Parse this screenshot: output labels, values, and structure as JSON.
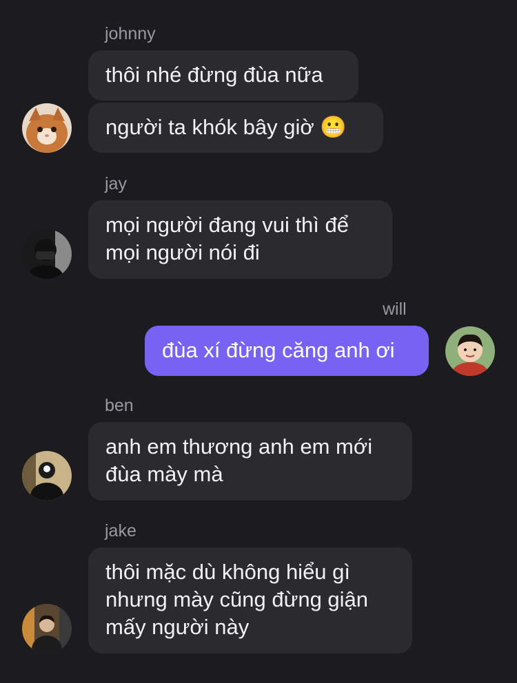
{
  "messages": [
    {
      "sender": "johnny",
      "bubbles": [
        {
          "lines": [
            "thôi nhé đừng đùa nữa"
          ]
        },
        {
          "lines": [
            "người ta khók bây giờ 😬"
          ]
        }
      ],
      "avatar_icon": "cat-avatar-icon"
    },
    {
      "sender": "jay",
      "bubbles": [
        {
          "lines": [
            "mọi người đang vui thì để",
            "mọi người nói đi"
          ]
        }
      ],
      "avatar_icon": "masked-person-avatar-icon"
    },
    {
      "sender": "will",
      "bubbles": [
        {
          "lines": [
            "đùa xí đừng căng anh ơi"
          ]
        }
      ],
      "avatar_icon": "child-avatar-icon"
    },
    {
      "sender": "ben",
      "bubbles": [
        {
          "lines": [
            "anh em thương anh em mới",
            "đùa mày mà"
          ]
        }
      ],
      "avatar_icon": "person-selfie-avatar-icon"
    },
    {
      "sender": "jake",
      "bubbles": [
        {
          "lines": [
            "thôi mặc dù không hiểu gì",
            "nhưng mày cũng đừng giận",
            "mấy người này"
          ]
        }
      ],
      "avatar_icon": "person-photo-avatar-icon"
    }
  ],
  "colors": {
    "background": "#1c1b20",
    "incoming_bubble": "#2b2b2f",
    "outgoing_bubble": "#7663f3",
    "sender_name": "#9a999f"
  }
}
